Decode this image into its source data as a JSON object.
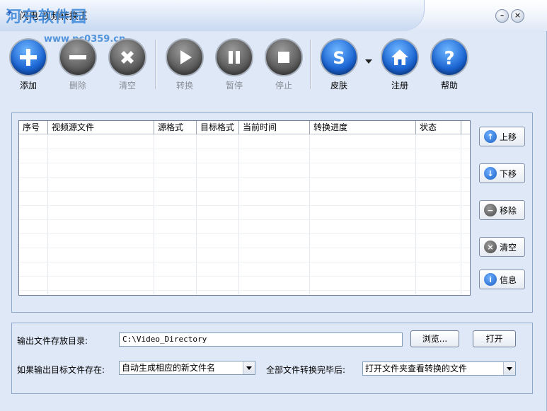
{
  "window": {
    "title": "闪电-视频转换王",
    "watermark_text": "河东软件园",
    "watermark_url": "www.pc0359.cn"
  },
  "toolbar": {
    "add": "添加",
    "delete": "删除",
    "clear": "清空",
    "convert": "转换",
    "pause": "暂停",
    "stop": "停止",
    "skin": "皮肤",
    "register": "注册",
    "help": "帮助"
  },
  "file_list": {
    "columns": [
      "序号",
      "视频源文件",
      "源格式",
      "目标格式",
      "当前时间",
      "转换进度",
      "状态"
    ],
    "rows": []
  },
  "side_buttons": {
    "move_up": "上移",
    "move_down": "下移",
    "remove": "移除",
    "clear": "清空",
    "info": "信息"
  },
  "options": {
    "output_dir_label": "输出文件存放目录:",
    "output_dir_value": "C:\\Video_Directory",
    "browse_label": "浏览...",
    "open_label": "打开",
    "exists_label": "如果输出目标文件存在:",
    "exists_selected": "自动生成相应的新文件名",
    "after_label": "全部文件转换完毕后:",
    "after_selected": "打开文件夹查看转换的文件"
  },
  "colors": {
    "window_bg": "#dfe8f7",
    "accent_blue": "#1a64d2",
    "disabled_gray": "#5c5c5c"
  }
}
